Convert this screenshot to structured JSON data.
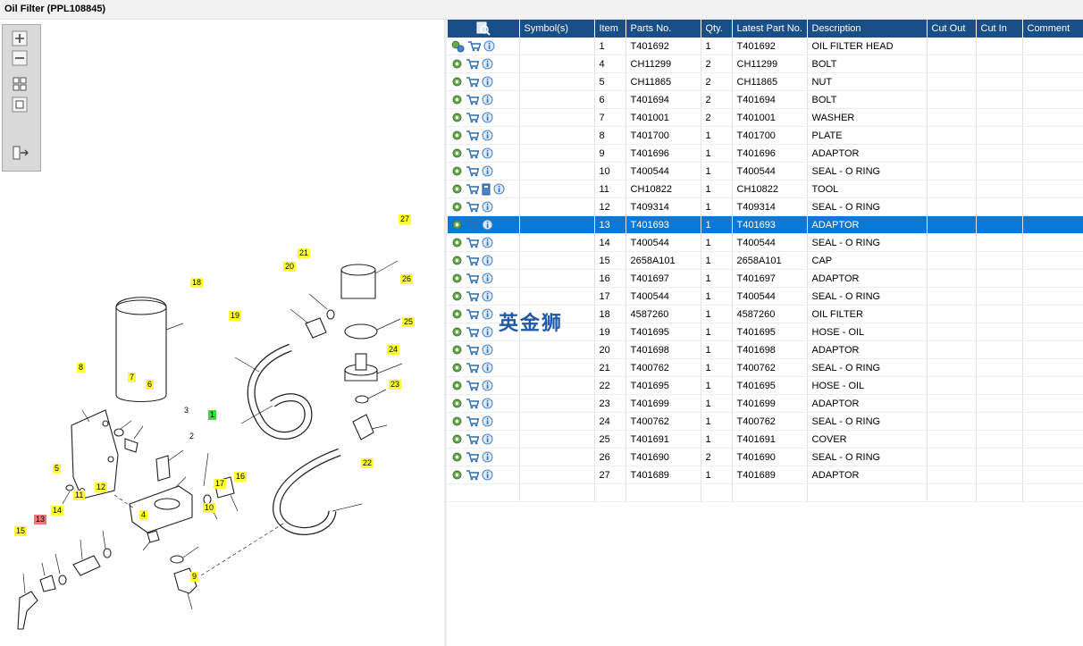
{
  "window": {
    "title": "Oil Filter (PPL108845)"
  },
  "toolbox": [
    {
      "name": "zoom-in-button"
    },
    {
      "name": "zoom-out-button"
    },
    {
      "name": "fit-all-button"
    },
    {
      "name": "fit-window-button"
    },
    {
      "name": "export-button"
    }
  ],
  "table": {
    "columns": [
      "",
      "Symbol(s)",
      "Item",
      "Parts No.",
      "Qty.",
      "Latest Part No.",
      "Description",
      "Cut Out",
      "Cut In",
      "Comment"
    ],
    "selected_item": "13",
    "rows": [
      {
        "item": "1",
        "part": "T401692",
        "qty": "1",
        "latest": "T401692",
        "desc": "OIL FILTER HEAD"
      },
      {
        "item": "4",
        "part": "CH11299",
        "qty": "2",
        "latest": "CH11299",
        "desc": "BOLT"
      },
      {
        "item": "5",
        "part": "CH11865",
        "qty": "2",
        "latest": "CH11865",
        "desc": "NUT"
      },
      {
        "item": "6",
        "part": "T401694",
        "qty": "2",
        "latest": "T401694",
        "desc": "BOLT"
      },
      {
        "item": "7",
        "part": "T401001",
        "qty": "2",
        "latest": "T401001",
        "desc": "WASHER"
      },
      {
        "item": "8",
        "part": "T401700",
        "qty": "1",
        "latest": "T401700",
        "desc": "PLATE"
      },
      {
        "item": "9",
        "part": "T401696",
        "qty": "1",
        "latest": "T401696",
        "desc": "ADAPTOR"
      },
      {
        "item": "10",
        "part": "T400544",
        "qty": "1",
        "latest": "T400544",
        "desc": "SEAL - O RING"
      },
      {
        "item": "11",
        "part": "CH10822",
        "qty": "1",
        "latest": "CH10822",
        "desc": "TOOL"
      },
      {
        "item": "12",
        "part": "T409314",
        "qty": "1",
        "latest": "T409314",
        "desc": "SEAL - O RING"
      },
      {
        "item": "13",
        "part": "T401693",
        "qty": "1",
        "latest": "T401693",
        "desc": "ADAPTOR"
      },
      {
        "item": "14",
        "part": "T400544",
        "qty": "1",
        "latest": "T400544",
        "desc": "SEAL - O RING"
      },
      {
        "item": "15",
        "part": "2658A101",
        "qty": "1",
        "latest": "2658A101",
        "desc": "CAP"
      },
      {
        "item": "16",
        "part": "T401697",
        "qty": "1",
        "latest": "T401697",
        "desc": "ADAPTOR"
      },
      {
        "item": "17",
        "part": "T400544",
        "qty": "1",
        "latest": "T400544",
        "desc": "SEAL - O RING"
      },
      {
        "item": "18",
        "part": "4587260",
        "qty": "1",
        "latest": "4587260",
        "desc": "OIL FILTER"
      },
      {
        "item": "19",
        "part": "T401695",
        "qty": "1",
        "latest": "T401695",
        "desc": "HOSE - OIL"
      },
      {
        "item": "20",
        "part": "T401698",
        "qty": "1",
        "latest": "T401698",
        "desc": "ADAPTOR"
      },
      {
        "item": "21",
        "part": "T400762",
        "qty": "1",
        "latest": "T400762",
        "desc": "SEAL - O RING"
      },
      {
        "item": "22",
        "part": "T401695",
        "qty": "1",
        "latest": "T401695",
        "desc": "HOSE - OIL"
      },
      {
        "item": "23",
        "part": "T401699",
        "qty": "1",
        "latest": "T401699",
        "desc": "ADAPTOR"
      },
      {
        "item": "24",
        "part": "T400762",
        "qty": "1",
        "latest": "T400762",
        "desc": "SEAL - O RING"
      },
      {
        "item": "25",
        "part": "T401691",
        "qty": "1",
        "latest": "T401691",
        "desc": "COVER"
      },
      {
        "item": "26",
        "part": "T401690",
        "qty": "2",
        "latest": "T401690",
        "desc": "SEAL - O RING"
      },
      {
        "item": "27",
        "part": "T401689",
        "qty": "1",
        "latest": "T401689",
        "desc": "ADAPTOR"
      }
    ]
  },
  "diagram": {
    "callouts": [
      "1",
      "2",
      "3",
      "4",
      "5",
      "6",
      "7",
      "8",
      "9",
      "10",
      "11",
      "12",
      "13",
      "14",
      "15",
      "16",
      "17",
      "18",
      "19",
      "20",
      "21",
      "22",
      "23",
      "24",
      "25",
      "26",
      "27"
    ],
    "highlight_green": "1",
    "highlight_red": "13"
  },
  "watermark": "英金狮",
  "colors": {
    "header": "#1a4e86",
    "selection": "#0a78d4",
    "callout": "#ffff33"
  }
}
